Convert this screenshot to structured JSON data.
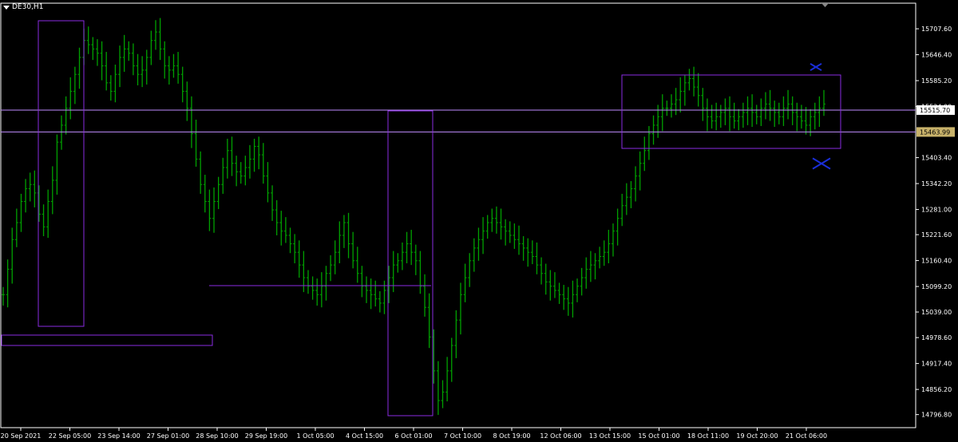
{
  "chart_title": "DE30,H1",
  "colors": {
    "background": "#000000",
    "frame": "#ffffff",
    "candles": "#00a000",
    "rectangles": "#8a2be2",
    "hlines": "#c08cff",
    "cross": "#1a2ed8",
    "price_label_bg": "#ffffff",
    "price_label2_bg": "#c8b26a"
  },
  "chart_data": {
    "type": "line",
    "title": "DE30,H1",
    "xlabel": "",
    "ylabel": "",
    "ylim": [
      14766,
      15768
    ],
    "grid": false,
    "y_ticks": [
      "15707.60",
      "15646.40",
      "15585.20",
      "15524.00",
      "15463.99",
      "15403.40",
      "15342.20",
      "15281.00",
      "15221.60",
      "15160.40",
      "15099.20",
      "15039.00",
      "14978.60",
      "14917.40",
      "14856.20",
      "14796.80"
    ],
    "y_tick_values": [
      15707.6,
      15646.4,
      15585.2,
      15524.0,
      15463.99,
      15403.4,
      15342.2,
      15281.0,
      15221.6,
      15160.4,
      15099.2,
      15039.0,
      14978.6,
      14917.4,
      14856.2,
      14796.8
    ],
    "x_ticks": [
      "20 Sep 2021",
      "22 Sep 05:00",
      "23 Sep 14:00",
      "27 Sep 01:00",
      "28 Sep 10:00",
      "29 Sep 19:00",
      "1 Oct 05:00",
      "4 Oct 15:00",
      "6 Oct 01:00",
      "7 Oct 10:00",
      "8 Oct 19:00",
      "12 Oct 06:00",
      "13 Oct 15:00",
      "15 Oct 01:00",
      "18 Oct 11:00",
      "19 Oct 20:00",
      "21 Oct 06:00"
    ],
    "price_labels": [
      {
        "text": "15515.70",
        "value": 15515.7
      },
      {
        "text": "15463.99",
        "value": 15463.99
      }
    ],
    "series": [
      {
        "values": [
          15080,
          15140,
          15210,
          15250,
          15300,
          15330,
          15340,
          15320,
          15270,
          15240,
          15300,
          15350,
          15440,
          15480,
          15520,
          15560,
          15600,
          15640,
          15680,
          15670,
          15660,
          15650,
          15620,
          15580,
          15560,
          15600,
          15640,
          15660,
          15650,
          15620,
          15600,
          15610,
          15640,
          15680,
          15700,
          15660,
          15620,
          15610,
          15620,
          15600,
          15560,
          15520,
          15460,
          15400,
          15340,
          15300,
          15260,
          15300,
          15340,
          15380,
          15420,
          15390,
          15370,
          15360,
          15380,
          15400,
          15430,
          15410,
          15360,
          15320,
          15280,
          15250,
          15230,
          15220,
          15200,
          15180,
          15150,
          15120,
          15100,
          15090,
          15080,
          15100,
          15130,
          15150,
          15180,
          15220,
          15250,
          15200,
          15160,
          15130,
          15100,
          15090,
          15080,
          15070,
          15060,
          15090,
          15120,
          15150,
          15160,
          15180,
          15200,
          15180,
          15160,
          15100,
          15050,
          14980,
          14900,
          14830,
          14850,
          14900,
          14960,
          15020,
          15080,
          15120,
          15160,
          15190,
          15210,
          15230,
          15250,
          15260,
          15250,
          15240,
          15230,
          15220,
          15210,
          15200,
          15190,
          15180,
          15170,
          15150,
          15130,
          15110,
          15100,
          15090,
          15080,
          15070,
          15060,
          15080,
          15100,
          15120,
          15140,
          15150,
          15160,
          15170,
          15180,
          15200,
          15230,
          15260,
          15290,
          15310,
          15330,
          15360,
          15390,
          15420,
          15460,
          15480,
          15500,
          15520,
          15520,
          15530,
          15540,
          15560,
          15580,
          15590,
          15570,
          15550,
          15520,
          15500,
          15490,
          15500,
          15510,
          15520,
          15500,
          15490,
          15500,
          15510,
          15520,
          15510,
          15500,
          15520,
          15530,
          15520,
          15510,
          15500,
          15520,
          15530,
          15510,
          15500,
          15490,
          15480,
          15500,
          15510,
          15520,
          15530
        ]
      }
    ]
  }
}
